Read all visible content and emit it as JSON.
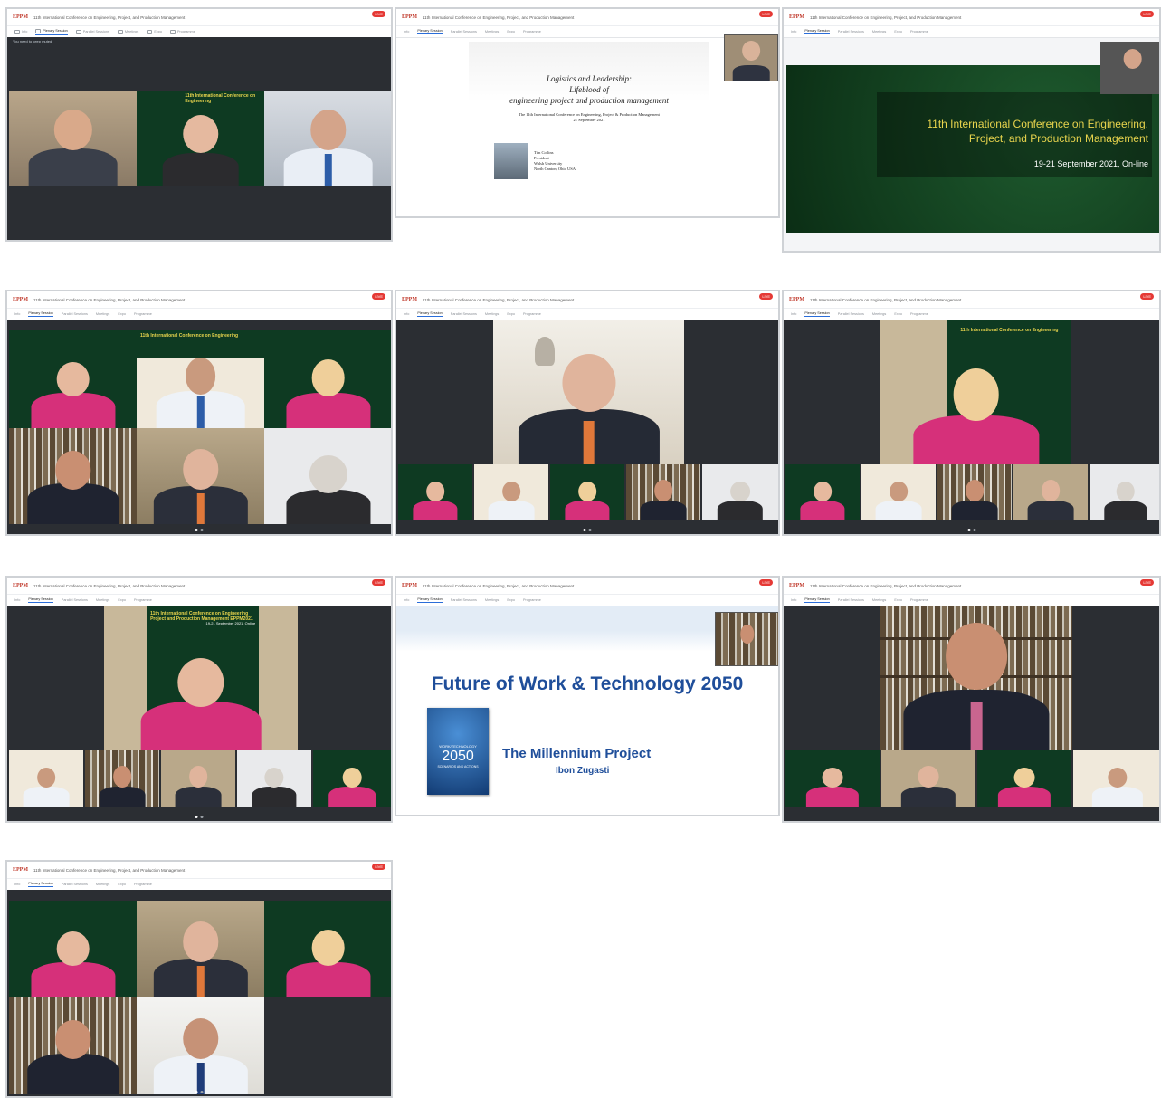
{
  "app": {
    "logo_text": "EPPM",
    "conference_title": "11th International Conference on Engineering, Project, and Production Management",
    "live_badge": "LIVE",
    "tabs": [
      {
        "label": "Info",
        "icon": "info-icon"
      },
      {
        "label": "Plenary Session",
        "icon": "mic-icon"
      },
      {
        "label": "Parallel Sessions",
        "icon": "screen-icon"
      },
      {
        "label": "Meetings",
        "icon": "video-icon"
      },
      {
        "label": "Expo",
        "icon": "grid-icon"
      },
      {
        "label": "Programme",
        "icon": "calendar-icon"
      }
    ],
    "active_tab": "Plenary Session"
  },
  "shot1": {
    "notice": "You need to keep muted"
  },
  "banner": {
    "line1": "11th International Conference on Engineering",
    "line2": "Project and Production Management EPPM2021",
    "dates": "19-21 September 2021, Online"
  },
  "slide_logistics": {
    "title1": "Logistics and Leadership:",
    "title2": "Lifeblood of",
    "title3": "engineering project and production management",
    "subtitle": "The 11th International Conference on Engineering, Project & Production Management",
    "date": "21 September 2021",
    "speaker_lines": [
      "Tim Collins",
      "President",
      "Walsh University",
      "North Canton, Ohio USA"
    ]
  },
  "slide_green": {
    "title1": "11th International Conference on Engineering,",
    "title2": "Project, and Production Management",
    "dates": "19-21 September 2021, On-line"
  },
  "slide_future": {
    "title": "Future of Work & Technology 2050",
    "project": "The Millennium Project",
    "speaker": "Ibon Zugasti",
    "book_top": "WORK/TECHNOLOGY",
    "book_year": "2050",
    "book_sub": "SCENARIOS AND ACTIONS"
  }
}
